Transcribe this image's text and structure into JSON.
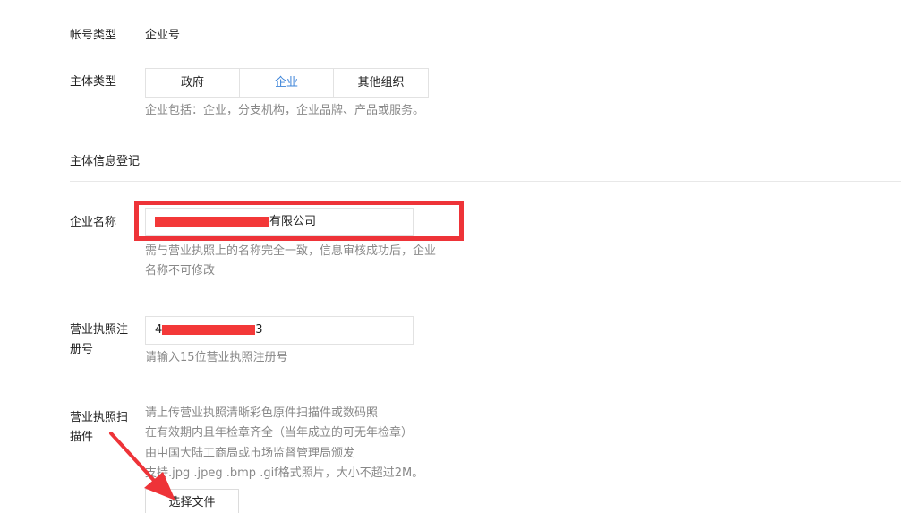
{
  "account": {
    "label": "帐号类型",
    "value": "企业号"
  },
  "entity_type": {
    "label": "主体类型",
    "options": [
      "政府",
      "企业",
      "其他组织"
    ],
    "selected": "企业",
    "hint": "企业包括：企业，分支机构，企业品牌、产品或服务。"
  },
  "section": {
    "title": "主体信息登记"
  },
  "company_name": {
    "label": "企业名称",
    "value_suffix": "有限公司",
    "hint_line1": "需与营业执照上的名称完全一致，信息审核成功后，企业",
    "hint_line2": "名称不可修改"
  },
  "license_number": {
    "label_line1": "营业执照注",
    "label_line2": "册号",
    "value_prefix": "4",
    "value_suffix": "3",
    "hint": "请输入15位营业执照注册号"
  },
  "license_scan": {
    "label_line1": "营业执照扫",
    "label_line2": "描件",
    "hint_line1": "请上传营业执照清晰彩色原件扫描件或数码照",
    "hint_line2": "在有效期内且年检章齐全（当年成立的可无年检章）",
    "hint_line3": "由中国大陆工商局或市场监督管理局颁发",
    "hint_line4": "支持.jpg .jpeg .bmp .gif格式照片，大小不超过2M。",
    "upload_label": "选择文件"
  },
  "colors": {
    "accent": "#3d84d9",
    "annotation_red": "#ee3338",
    "hint_text": "#888888"
  }
}
